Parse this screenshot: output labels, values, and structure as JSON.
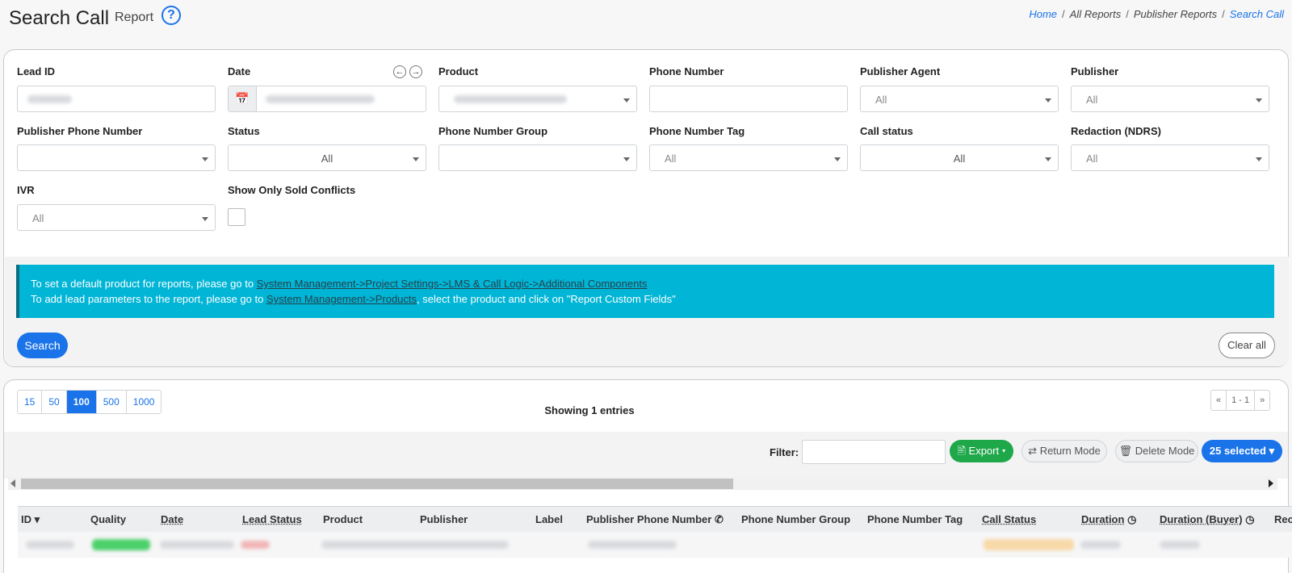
{
  "header": {
    "title": "Search Call",
    "subtitle": "Report",
    "help": "?",
    "breadcrumb": [
      "Home",
      "All Reports",
      "Publisher Reports",
      "Search Call"
    ]
  },
  "filters": {
    "lead_id": {
      "label": "Lead ID"
    },
    "date": {
      "label": "Date",
      "prev": "←",
      "next": "→"
    },
    "product": {
      "label": "Product"
    },
    "phone_number": {
      "label": "Phone Number"
    },
    "publisher_agent": {
      "label": "Publisher Agent",
      "value": "All"
    },
    "publisher": {
      "label": "Publisher",
      "value": "All"
    },
    "publisher_phone_number": {
      "label": "Publisher Phone Number"
    },
    "status": {
      "label": "Status",
      "value": "All"
    },
    "phone_number_group": {
      "label": "Phone Number Group"
    },
    "phone_number_tag": {
      "label": "Phone Number Tag",
      "value": "All"
    },
    "call_status": {
      "label": "Call status",
      "value": "All"
    },
    "redaction": {
      "label": "Redaction (NDRS)",
      "value": "All"
    },
    "ivr": {
      "label": "IVR",
      "value": "All"
    },
    "sold_conflicts": {
      "label": "Show Only Sold Conflicts"
    }
  },
  "info": {
    "line1_text": "To set a default product for reports, please go to ",
    "line1_link": "System Management->Project Settings->LMS & Call Logic->Additional Components",
    "line2_text": "To add lead parameters to the report, please go to ",
    "line2_link": "System Management->Products",
    "line2_suffix": ", select the product and click on \"Report Custom Fields\""
  },
  "actions": {
    "search": "Search",
    "clear": "Clear all"
  },
  "pagination": {
    "sizes": [
      "15",
      "50",
      "100",
      "500",
      "1000"
    ],
    "selected": "100",
    "showing": "Showing 1 entries",
    "first": "«",
    "range": "1 - 1",
    "last": "»"
  },
  "toolbar": {
    "filter_label": "Filter:",
    "export": "Export",
    "return_mode": "Return Mode",
    "delete_mode": "Delete Mode",
    "selected": "25 selected"
  },
  "table": {
    "columns": [
      "ID",
      "Quality",
      "Date",
      "Lead Status",
      "Product",
      "Publisher",
      "Label",
      "Publisher Phone Number",
      "Phone Number Group",
      "Phone Number Tag",
      "Call Status",
      "Duration",
      "Duration (Buyer)",
      "Rec"
    ]
  },
  "colors": {
    "primary": "#1a73e8",
    "info": "#00b5d6",
    "success": "#1fa84a"
  }
}
